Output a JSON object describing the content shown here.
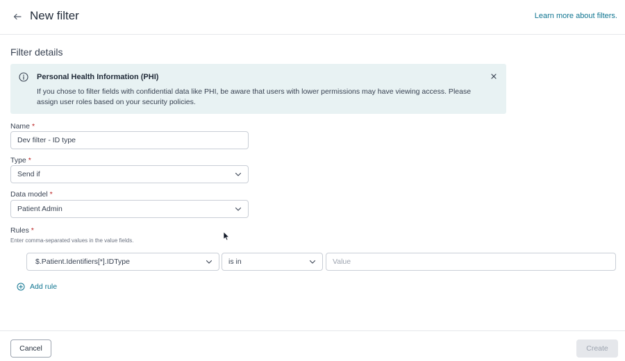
{
  "header": {
    "title": "New filter",
    "learn_more": "Learn more about filters."
  },
  "section": {
    "title": "Filter details"
  },
  "banner": {
    "title": "Personal Health Information (PHI)",
    "text": "If you chose to filter fields with confidential data like PHI, be aware that users with lower permissions may have viewing access. Please assign user roles based on your security policies."
  },
  "form": {
    "name": {
      "label": "Name",
      "required": "*",
      "value": "Dev filter - ID type"
    },
    "type": {
      "label": "Type",
      "required": "*",
      "value": "Send if"
    },
    "data_model": {
      "label": "Data model",
      "required": "*",
      "value": "Patient Admin"
    },
    "rules": {
      "label": "Rules",
      "required": "*",
      "hint": "Enter comma-separated values in the value fields.",
      "field": "$.Patient.Identifiers[*].IDType",
      "operator": "is in",
      "value_placeholder": "Value"
    },
    "add_rule": "Add rule"
  },
  "footer": {
    "cancel": "Cancel",
    "create": "Create"
  },
  "colors": {
    "accent": "#0e7490",
    "banner_bg": "#e8f2f3",
    "required": "#b91c1c",
    "disabled_bg": "#e5e7eb"
  },
  "icons": {
    "back": "arrow-left-icon",
    "info": "info-circle-icon",
    "close": "close-icon",
    "chevron": "chevron-down-icon",
    "add": "plus-circle-icon"
  }
}
